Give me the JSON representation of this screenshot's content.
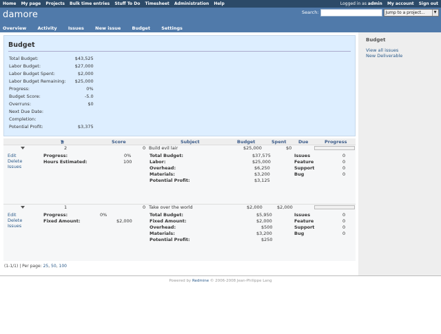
{
  "top_menu": {
    "items": [
      "Home",
      "My page",
      "Projects",
      "Bulk time entries",
      "Stuff To Do",
      "Timesheet",
      "Administration",
      "Help"
    ],
    "logged_in_prefix": "Logged in as",
    "user": "admin",
    "my_account": "My account",
    "sign_out": "Sign out"
  },
  "header": {
    "title": "damore",
    "search_label": "Search:",
    "jump_label": "Jump to a project...",
    "main_menu": [
      "Overview",
      "Activity",
      "Issues",
      "New issue",
      "Budget",
      "Settings"
    ]
  },
  "budget": {
    "title": "Budget",
    "rows": [
      {
        "label": "Total Budget:",
        "value": "$43,525"
      },
      {
        "label": "Labor Budget:",
        "value": "$27,000"
      },
      {
        "label": "Labor Budget Spent:",
        "value": "$2,000"
      },
      {
        "label": "Labor Budget Remaining:",
        "value": "$25,000"
      },
      {
        "label": "Progress:",
        "value": "0%"
      },
      {
        "label": "Budget Score:",
        "value": "-5.0"
      },
      {
        "label": "Overruns:",
        "value": "$0"
      },
      {
        "label": "Next Due Date:",
        "value": ""
      },
      {
        "label": "Completion:",
        "value": ""
      },
      {
        "label": "Potential Profit:",
        "value": "$3,375"
      }
    ]
  },
  "table": {
    "columns": {
      "num": "#",
      "score": "Score",
      "subject": "Subject",
      "budget": "Budget",
      "spent": "Spent",
      "due": "Due",
      "progress": "Progress"
    },
    "rows": [
      {
        "num": "2",
        "score": "0",
        "subject": "Build evil lair",
        "budget": "$25,000",
        "spent": "$0",
        "due": "",
        "progress_pct": 0,
        "links": [
          "Edit",
          "Delete",
          "Issues"
        ],
        "left": [
          {
            "label": "Progress:",
            "value": "0%"
          },
          {
            "label": "Hours Estimated:",
            "value": "100"
          }
        ],
        "middle": [
          {
            "label": "Total Budget:",
            "value": "$37,575"
          },
          {
            "label": "Labor:",
            "value": "$25,000"
          },
          {
            "label": "Overhead:",
            "value": "$6,250"
          },
          {
            "label": "Materials:",
            "value": "$3,200"
          },
          {
            "label": "Potential Profit:",
            "value": "$3,125"
          }
        ],
        "right": [
          {
            "label": "Issues",
            "value": "0"
          },
          {
            "label": "Feature",
            "value": "0"
          },
          {
            "label": "Support",
            "value": "0"
          },
          {
            "label": "Bug",
            "value": "0"
          }
        ]
      },
      {
        "num": "1",
        "score": "0",
        "subject": "Take over the world",
        "budget": "$2,000",
        "spent": "$2,000",
        "due": "",
        "progress_pct": 0,
        "links": [
          "Edit",
          "Delete",
          "Issues"
        ],
        "left": [
          {
            "label": "Progress:",
            "value": "0%"
          },
          {
            "label": "Fixed Amount:",
            "value": "$2,000"
          }
        ],
        "middle": [
          {
            "label": "Total Budget:",
            "value": "$5,950"
          },
          {
            "label": "Fixed Amount:",
            "value": "$2,000"
          },
          {
            "label": "Overhead:",
            "value": "$500"
          },
          {
            "label": "Materials:",
            "value": "$3,200"
          },
          {
            "label": "Potential Profit:",
            "value": "$250"
          }
        ],
        "right": [
          {
            "label": "Issues",
            "value": "0"
          },
          {
            "label": "Feature",
            "value": "0"
          },
          {
            "label": "Support",
            "value": "0"
          },
          {
            "label": "Bug",
            "value": "0"
          }
        ]
      }
    ]
  },
  "pagination": {
    "text": "(1-1/1) | Per page:",
    "options": [
      "25",
      "50",
      "100"
    ]
  },
  "sidebar": {
    "title": "Budget",
    "links": [
      "View all issues",
      "New Deliverable"
    ]
  },
  "footer": {
    "prefix": "Powered by",
    "link": "Redmine",
    "suffix": "© 2006-2008 Jean-Philippe Lang"
  }
}
